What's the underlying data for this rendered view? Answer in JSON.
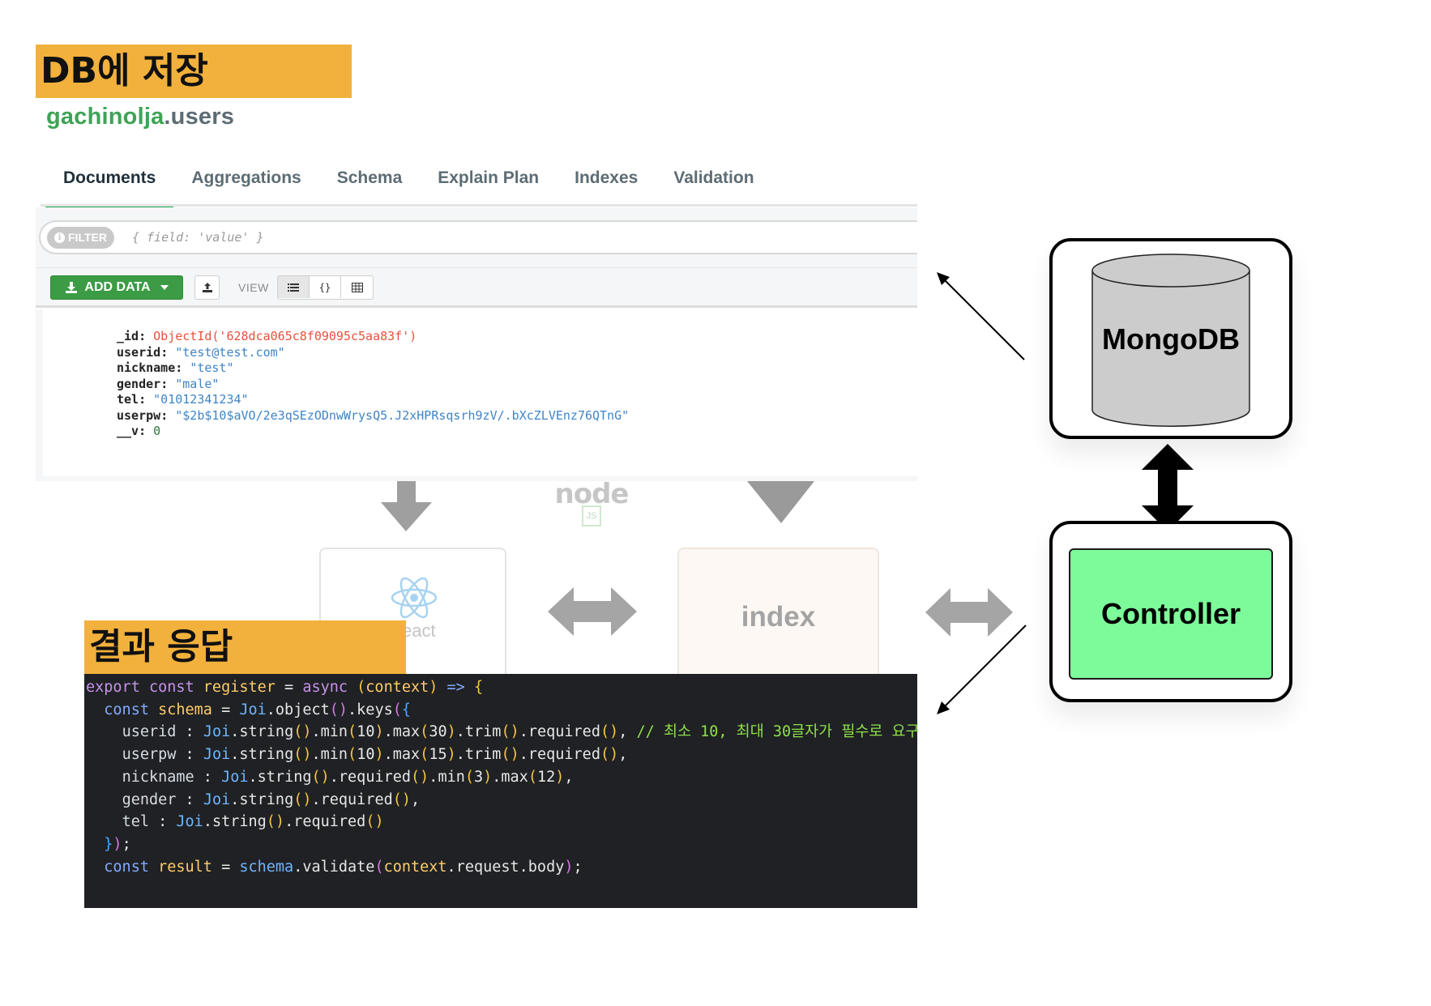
{
  "labels": {
    "db_save": "DB에 저장",
    "result_response": "결과 응답"
  },
  "compass": {
    "collection": {
      "db": "gachinolja",
      "name": ".users"
    },
    "tabs": [
      {
        "label": "Documents",
        "active": true
      },
      {
        "label": "Aggregations",
        "active": false
      },
      {
        "label": "Schema",
        "active": false
      },
      {
        "label": "Explain Plan",
        "active": false
      },
      {
        "label": "Indexes",
        "active": false
      },
      {
        "label": "Validation",
        "active": false
      }
    ],
    "filter": {
      "label": "FILTER",
      "placeholder": "{ field: 'value' }"
    },
    "toolbar": {
      "add_data": "ADD DATA",
      "view_label": "VIEW",
      "view_options": [
        "list-icon",
        "json-icon",
        "table-icon"
      ]
    },
    "document": [
      {
        "key": "_id",
        "value": "ObjectId('628dca065c8f09095c5aa83f')",
        "type": "oid"
      },
      {
        "key": "userid",
        "value": "\"test@test.com\"",
        "type": "str"
      },
      {
        "key": "nickname",
        "value": "\"test\"",
        "type": "str"
      },
      {
        "key": "gender",
        "value": "\"male\"",
        "type": "str"
      },
      {
        "key": "tel",
        "value": "\"01012341234\"",
        "type": "str"
      },
      {
        "key": "userpw",
        "value": "\"$2b$10$aVO/2e3qSEzODnwWrysQ5.J2xHPRsqsrh9zV/.bXcZLVEnz76QTnG\"",
        "type": "str"
      },
      {
        "key": "__v",
        "value": "0",
        "type": "num"
      }
    ]
  },
  "background_diagram": {
    "node_logo": "node",
    "node_sub": "JS",
    "react_label": "eact",
    "index_label": "index"
  },
  "code": {
    "lines": [
      "export const register = async (context) => {",
      "  const schema = Joi.object().keys({",
      "    userid : Joi.string().min(10).max(30).trim().required(), // 최소 10, 최대 30글자가 필수로 요구",
      "    userpw : Joi.string().min(10).max(15).trim().required(),",
      "    nickname : Joi.string().required().min(3).max(12),",
      "    gender : Joi.string().required(),",
      "    tel : Joi.string().required()",
      "  });",
      "  const result = schema.validate(context.request.body);"
    ]
  },
  "diagram": {
    "mongodb_label": "MongoDB",
    "controller_label": "Controller"
  }
}
